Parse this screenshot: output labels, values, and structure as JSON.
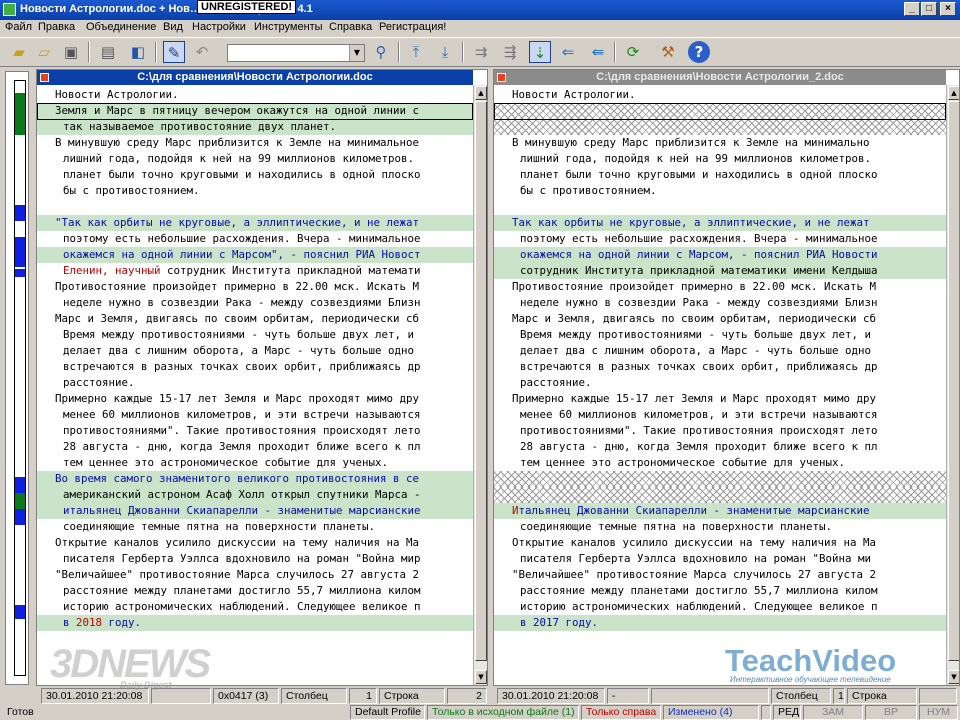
{
  "window": {
    "title": "Новости Астрологии.doc + Нов….doc - Compare It! 4.1",
    "unregistered": "UNREGISTERED!"
  },
  "menu": [
    "Файл",
    "Правка",
    "Объединение",
    "Вид",
    "Настройки",
    "Инструменты",
    "Справка",
    "Регистрация!"
  ],
  "toolbar": {
    "combo_value": "",
    "icons": [
      "open-folder-icon",
      "open-pair-icon",
      "save-icon",
      "print-icon",
      "print-preview-icon",
      "edit-icon",
      "undo-icon",
      "search-icon",
      "top-icon",
      "bottom-icon",
      "copy-left-icon",
      "copy-right-icon",
      "merge-icon",
      "move-left-icon",
      "move-left-all-icon",
      "refresh-icon",
      "tools-icon",
      "help-icon"
    ]
  },
  "left_pane": {
    "header": "C:\\для сравнения\\Новости Астрологии.doc",
    "lines": [
      {
        "t": "Новости Астрологии.",
        "c": ""
      },
      {
        "t": "Земля и Марс в пятницу вечером окажутся на одной линии с",
        "c": "g"
      },
      {
        "t": "так называемое противостояние двух планет.",
        "c": "g",
        "cont": true
      },
      {
        "t": "В минувшую среду Марс приблизится к Земле на минимальное",
        "c": ""
      },
      {
        "t": "лишний года, подойдя к ней на 99 миллионов километров.",
        "c": "",
        "cont": true
      },
      {
        "t": "планет были точно круговыми и находились в одной плоско",
        "c": "",
        "cont": true
      },
      {
        "t": "бы с противостоянием.",
        "c": "",
        "cont": true
      },
      {
        "t": "",
        "c": ""
      },
      {
        "t": "\"Так как орбиты не круговые, а эллиптические, и не лежат",
        "c": "gb"
      },
      {
        "t": "поэтому есть небольшие расхождения. Вчера - минимальное",
        "c": "",
        "cont": true
      },
      {
        "t": "окажемся на одной линии с Марсом\", - пояснил РИА Новост",
        "c": "gb",
        "cont": true
      },
      {
        "segs": [
          {
            "t": "Еленин, научный",
            "c": "red"
          },
          {
            "t": " сотрудник Института прикладной математи",
            "c": ""
          }
        ],
        "c": "",
        "cont": true
      },
      {
        "t": "Противостояние произойдет примерно в 22.00 мск. Искать М",
        "c": ""
      },
      {
        "t": "неделе нужно в созвездии Рака - между созвездиями Близн",
        "c": "",
        "cont": true
      },
      {
        "t": "Марс и Земля, двигаясь по своим орбитам, периодически сб",
        "c": ""
      },
      {
        "t": "Время между противостояниями - чуть больше двух лет, и",
        "c": "",
        "cont": true
      },
      {
        "t": "делает два с лишним оборота, а Марс - чуть больше одно",
        "c": "",
        "cont": true
      },
      {
        "t": "встречаются в разных точках своих орбит, приближаясь др",
        "c": "",
        "cont": true
      },
      {
        "t": "расстояние.",
        "c": "",
        "cont": true
      },
      {
        "t": "Примерно каждые 15-17 лет Земля и Марс проходят мимо дру",
        "c": ""
      },
      {
        "t": "менее 60 миллионов километров, и эти встречи называются",
        "c": "",
        "cont": true
      },
      {
        "t": "противостояниями\". Такие противостояния происходят лето",
        "c": "",
        "cont": true
      },
      {
        "t": "28 августа - дню, когда Земля проходит ближе всего к пл",
        "c": "",
        "cont": true
      },
      {
        "t": "тем ценнее это астрономическое событие для ученых.",
        "c": "",
        "cont": true
      },
      {
        "t": "Во время самого знаменитого великого противостояния в се",
        "c": "gb"
      },
      {
        "t": "американский астроном Асаф Холл открыл спутники Марса -",
        "c": "g",
        "cont": true
      },
      {
        "t": "итальянец Джованни Скиапарелли - знаменитые марсианские",
        "c": "gb",
        "cont": true
      },
      {
        "t": "соединяющие темные пятна на поверхности планеты.",
        "c": "",
        "cont": true
      },
      {
        "t": "Открытие каналов усилило дискуссии на тему наличия на Ма",
        "c": ""
      },
      {
        "t": "писателя Герберта Уэллса вдохновило на роман \"Война мир",
        "c": "",
        "cont": true
      },
      {
        "t": "\"Величайшее\" противостояние Марса случилось 27 августа 2",
        "c": ""
      },
      {
        "t": "расстояние между планетами достигло 55,7 миллиона килом",
        "c": "",
        "cont": true
      },
      {
        "t": "историю астрономических наблюдений. Следующее великое п",
        "c": "",
        "cont": true
      },
      {
        "segs": [
          {
            "t": "в ",
            "c": "gb"
          },
          {
            "t": "2018",
            "c": "red"
          },
          {
            "t": " году.",
            "c": "gb"
          }
        ],
        "c": "g",
        "cont": true
      }
    ],
    "info": {
      "date": "30.01.2010  21:20:08",
      "dash": "",
      "code": "0x0417 (3)",
      "col_label": "Столбец",
      "col_val": "1",
      "row_label": "Строка",
      "row_val": "2"
    }
  },
  "right_pane": {
    "header": "C:\\для сравнения\\Новости Астрологии_2.doc",
    "lines": [
      {
        "t": "Новости Астрологии.",
        "c": ""
      },
      {
        "t": "",
        "c": "x"
      },
      {
        "t": "",
        "c": "x"
      },
      {
        "t": "В минувшую среду Марс приблизится к Земле на минимально",
        "c": ""
      },
      {
        "t": "лишний года, подойдя к ней на 99 миллионов километров.",
        "c": "",
        "cont": true
      },
      {
        "t": "планет были точно круговыми и находились в одной плоско",
        "c": "",
        "cont": true
      },
      {
        "t": "бы с противостоянием.",
        "c": "",
        "cont": true
      },
      {
        "t": "",
        "c": ""
      },
      {
        "t": "Так как орбиты не круговые, а эллиптические, и не лежат",
        "c": "gb"
      },
      {
        "t": "поэтому есть небольшие расхождения. Вчера - минимальное",
        "c": "",
        "cont": true
      },
      {
        "t": "окажемся на одной линии с Марсом, - пояснил РИА Новости",
        "c": "gb",
        "cont": true
      },
      {
        "t": "сотрудник Института прикладной математики имени Келдыша",
        "c": "g",
        "cont": true
      },
      {
        "t": "Противостояние произойдет примерно в 22.00 мск. Искать М",
        "c": ""
      },
      {
        "t": "неделе нужно в созвездии Рака - между созвездиями Близн",
        "c": "",
        "cont": true
      },
      {
        "t": "Марс и Земля, двигаясь по своим орбитам, периодически сб",
        "c": ""
      },
      {
        "t": "Время между противостояниями - чуть больше двух лет, и",
        "c": "",
        "cont": true
      },
      {
        "t": "делает два с лишним оборота, а Марс - чуть больше одно",
        "c": "",
        "cont": true
      },
      {
        "t": "встречаются в разных точках своих орбит, приближаясь др",
        "c": "",
        "cont": true
      },
      {
        "t": "расстояние.",
        "c": "",
        "cont": true
      },
      {
        "t": "Примерно каждые 15-17 лет Земля и Марс проходят мимо дру",
        "c": ""
      },
      {
        "t": "менее 60 миллионов километров, и эти встречи называются",
        "c": "",
        "cont": true
      },
      {
        "t": "противостояниями\". Такие противостояния происходят лето",
        "c": "",
        "cont": true
      },
      {
        "t": "28 августа - дню, когда Земля проходит ближе всего к пл",
        "c": "",
        "cont": true
      },
      {
        "t": "тем ценнее это астрономическое событие для ученых.",
        "c": "",
        "cont": true
      },
      {
        "t": "",
        "c": "x"
      },
      {
        "t": "",
        "c": "x"
      },
      {
        "segs": [
          {
            "t": "И",
            "c": "red"
          },
          {
            "t": "тальянец Джованни Скиапарелли - знаменитые марсианские",
            "c": "gb"
          }
        ],
        "c": "g"
      },
      {
        "t": "соединяющие темные пятна на поверхности планеты.",
        "c": "",
        "cont": true
      },
      {
        "t": "Открытие каналов усилило дискуссии на тему наличия на Ма",
        "c": ""
      },
      {
        "t": "писателя Герберта Уэллса вдохновило на роман \"Война ми",
        "c": "",
        "cont": true
      },
      {
        "t": "\"Величайшее\" противостояние Марса случилось 27 августа 2",
        "c": ""
      },
      {
        "t": "расстояние между планетами достигло 55,7 миллиона килом",
        "c": "",
        "cont": true
      },
      {
        "t": "историю астрономических наблюдений. Следующее великое п",
        "c": "",
        "cont": true
      },
      {
        "segs": [
          {
            "t": "в ",
            "c": "gb"
          },
          {
            "t": "2017",
            "c": "gb"
          },
          {
            "t": " году.",
            "c": "gb"
          }
        ],
        "c": "g",
        "cont": true
      }
    ],
    "info": {
      "date": "30.01.2010  21:20:08",
      "dash": "-",
      "code": "",
      "col_label": "Столбец",
      "col_val": "1",
      "row_label": "Строка",
      "row_val": ""
    }
  },
  "status": {
    "ready": "Готов",
    "profile": "Default Profile",
    "only_source": "Только в исходном файле (1)",
    "only_right": "Только справа",
    "changed": "Изменено (4)",
    "ins": "",
    "red": "РЕД",
    "zam": "ЗАМ",
    "vr": "ВР",
    "num": "НУМ"
  },
  "colors": {
    "green_bg": "#c9e4c9",
    "blue_text": "#0a0aa8",
    "red_text": "#c00000",
    "title_active": "#0a3fa8",
    "title_inactive": "#808080"
  },
  "watermarks": {
    "left": "3DNEWS",
    "left_sub": "Daily Digest",
    "right": "TeachVideo",
    "right_sub": "Интерактивное обучающее телевидение"
  }
}
